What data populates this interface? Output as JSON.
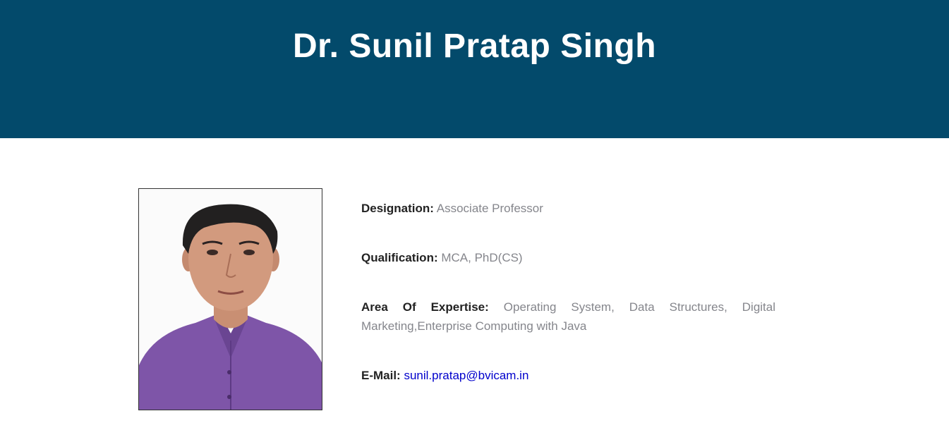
{
  "header": {
    "name": "Dr. Sunil Pratap Singh"
  },
  "profile": {
    "photo_alt": "Profile photo",
    "fields": {
      "designation": {
        "label": "Designation:",
        "value": "Associate Professor"
      },
      "qualification": {
        "label": "Qualification:",
        "value": "MCA, PhD(CS)"
      },
      "expertise": {
        "label": "Area Of Expertise:",
        "value": "Operating System, Data Structures, Digital Marketing,Enterprise Computing with Java"
      },
      "email": {
        "label": "E-Mail:",
        "value": "sunil.pratap@bvicam.in"
      }
    }
  },
  "colors": {
    "header_bg": "#034a6b",
    "label": "#222222",
    "value": "#85868c",
    "link": "#0000cc"
  }
}
